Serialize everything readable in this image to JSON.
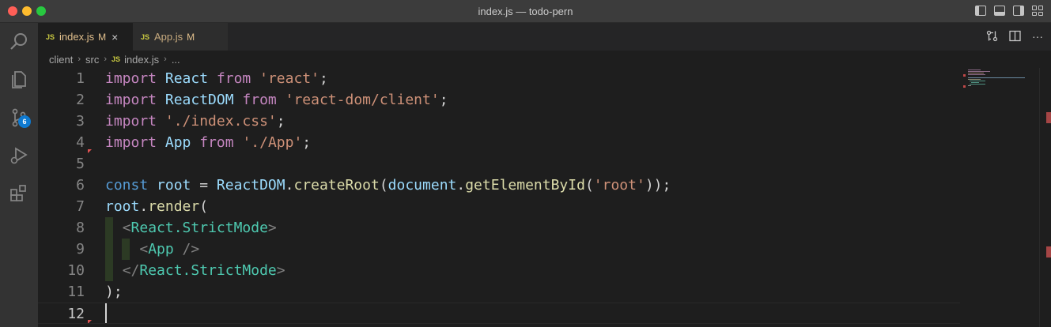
{
  "window": {
    "title": "index.js — todo-pern"
  },
  "activity": {
    "source_control_badge": "6"
  },
  "tabs": [
    {
      "icon": "JS",
      "name": "index.js",
      "status": "M",
      "close": "×"
    },
    {
      "icon": "JS",
      "name": "App.js",
      "status": "M"
    }
  ],
  "tab_actions": {
    "more": "···"
  },
  "breadcrumb": {
    "parts": [
      "client",
      "src"
    ],
    "file_icon": "JS",
    "file": "index.js",
    "tail": "..."
  },
  "editor": {
    "line_numbers": [
      "1",
      "2",
      "3",
      "4",
      "5",
      "6",
      "7",
      "8",
      "9",
      "10",
      "11",
      "12"
    ],
    "current_line": "12",
    "code": {
      "l1": {
        "kw1": "import",
        "id": "React",
        "kw2": "from",
        "str": "'react'",
        "end": ";"
      },
      "l2": {
        "kw1": "import",
        "id": "ReactDOM",
        "kw2": "from",
        "str": "'react-dom/client'",
        "end": ";"
      },
      "l3": {
        "kw1": "import",
        "str": "'./index.css'",
        "end": ";"
      },
      "l4": {
        "kw1": "import",
        "id": "App",
        "kw2": "from",
        "str": "'./App'",
        "end": ";"
      },
      "l6": {
        "kw": "const",
        "id": "root",
        "eq": " = ",
        "obj": "ReactDOM",
        "dot": ".",
        "fn": "createRoot",
        "p1": "(",
        "obj2": "document",
        "dot2": ".",
        "fn2": "getElementById",
        "p2": "(",
        "str": "'root'",
        "end": "));"
      },
      "l7": {
        "obj": "root",
        "dot": ".",
        "fn": "render",
        "p": "("
      },
      "l8": {
        "open": "<",
        "tag": "React.StrictMode",
        "close": ">"
      },
      "l9": {
        "open": "<",
        "tag": "App",
        "close": " />"
      },
      "l10": {
        "open": "</",
        "tag": "React.StrictMode",
        "close": ">"
      },
      "l11": {
        "text": ");"
      }
    }
  },
  "colors": {
    "keyword": "#c586c0",
    "string": "#ce9178",
    "variable": "#9cdcfe",
    "function": "#dcdcaa",
    "const": "#569cd6",
    "tag": "#4ec9b0",
    "badge": "#0e7ad1"
  }
}
